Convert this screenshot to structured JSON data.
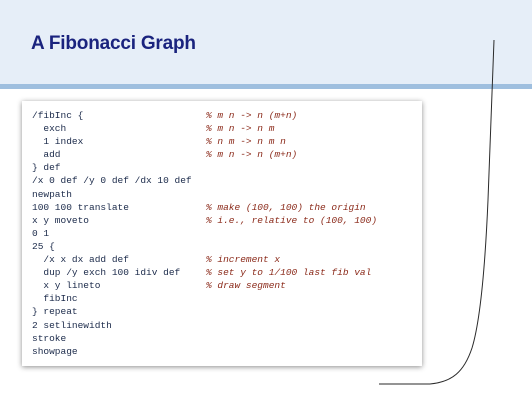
{
  "slide": {
    "title": "A Fibonacci Graph"
  },
  "code": {
    "lines": [
      {
        "code": "/fibInc {",
        "comment": "% m n -> n (m+n)"
      },
      {
        "code": "  exch",
        "comment": "% m n -> n m"
      },
      {
        "code": "  1 index",
        "comment": "% n m -> n m n"
      },
      {
        "code": "  add",
        "comment": "% m n -> n (m+n)"
      },
      {
        "code": "} def",
        "comment": ""
      },
      {
        "code": "/x 0 def /y 0 def /dx 10 def",
        "comment": ""
      },
      {
        "code": "newpath",
        "comment": ""
      },
      {
        "code": "100 100 translate",
        "comment": "% make (100, 100) the origin"
      },
      {
        "code": "x y moveto",
        "comment": "% i.e., relative to (100, 100)"
      },
      {
        "code": "0 1",
        "comment": ""
      },
      {
        "code": "25 {",
        "comment": ""
      },
      {
        "code": "  /x x dx add def",
        "comment": "% increment x"
      },
      {
        "code": "  dup /y exch 100 idiv def",
        "comment": "% set y to 1/100 last fib val"
      },
      {
        "code": "  x y lineto",
        "comment": "% draw segment"
      },
      {
        "code": "  fibInc",
        "comment": ""
      },
      {
        "code": "} repeat",
        "comment": ""
      },
      {
        "code": "2 setlinewidth",
        "comment": ""
      },
      {
        "code": "stroke",
        "comment": ""
      },
      {
        "code": "showpage",
        "comment": ""
      }
    ]
  },
  "colors": {
    "title": "#1a237e",
    "header_band": "#e6eef8",
    "header_rule": "#9fbfdf",
    "code_text": "#1b2a4a",
    "comment_text": "#8b2a1a",
    "graph_line": "#2a2a2a"
  }
}
